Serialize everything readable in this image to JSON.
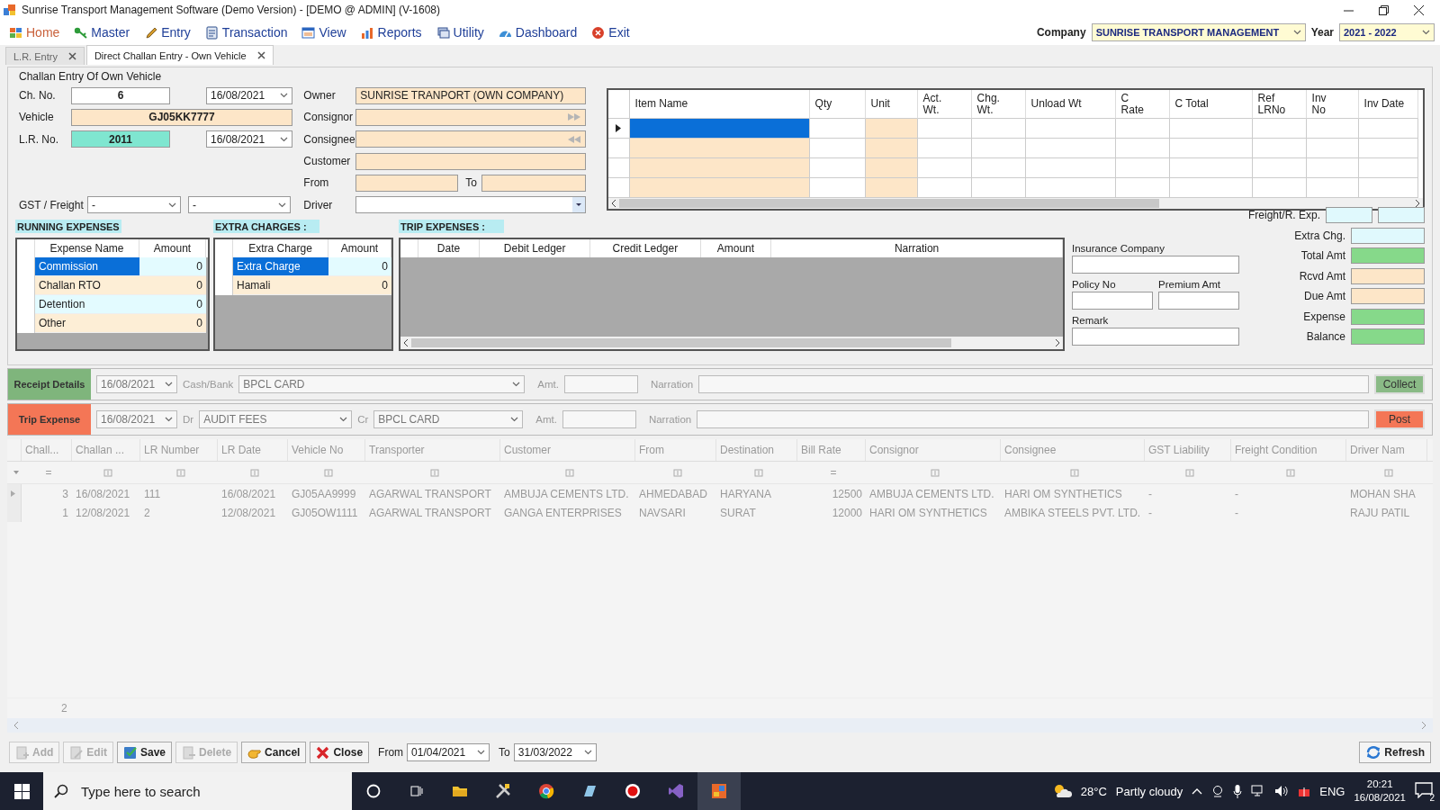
{
  "window": {
    "title": "Sunrise Transport Management Software (Demo Version) - [DEMO @ ADMIN] (V-1608)"
  },
  "menu": [
    {
      "label": "Home",
      "selected": true
    },
    {
      "label": "Master",
      "selected": false
    },
    {
      "label": "Entry",
      "selected": false
    },
    {
      "label": "Transaction",
      "selected": false
    },
    {
      "label": "View",
      "selected": false
    },
    {
      "label": "Reports",
      "selected": false
    },
    {
      "label": "Utility",
      "selected": false
    },
    {
      "label": "Dashboard",
      "selected": false
    },
    {
      "label": "Exit",
      "selected": false
    }
  ],
  "company": {
    "label": "Company",
    "value": "SUNRISE TRANSPORT MANAGEMENT"
  },
  "year": {
    "label": "Year",
    "value": "2021 - 2022"
  },
  "tabs": [
    {
      "label": "L.R. Entry",
      "selected": false
    },
    {
      "label": "Direct Challan Entry - Own Vehicle",
      "selected": true
    }
  ],
  "challan_form": {
    "title": "Challan Entry Of Own Vehicle",
    "ch_no": {
      "label": "Ch. No.",
      "value": "6",
      "date": "16/08/2021"
    },
    "vehicle": {
      "label": "Vehicle",
      "value": "GJ05KK7777"
    },
    "lr_no": {
      "label": "L.R. No.",
      "value": "2011",
      "date": "16/08/2021"
    },
    "gst_freight": {
      "label": "GST / Freight",
      "values": [
        "-",
        "-"
      ]
    },
    "owner": {
      "label": "Owner",
      "value": "SUNRISE TRANPORT (OWN COMPANY)"
    },
    "consignor": {
      "label": "Consignor"
    },
    "consignee": {
      "label": "Consignee"
    },
    "customer": {
      "label": "Customer"
    },
    "from": {
      "label": "From"
    },
    "to": {
      "label": "To"
    },
    "driver": {
      "label": "Driver"
    }
  },
  "item_grid": {
    "columns": [
      {
        "label": "Item Name",
        "required": true
      },
      {
        "label": "Qty",
        "required": false
      },
      {
        "label": "Unit",
        "required": true
      },
      {
        "label": "Act.\nWt.",
        "required": false
      },
      {
        "label": "Chg.\nWt.",
        "required": false
      },
      {
        "label": "Unload Wt",
        "required": false
      },
      {
        "label": "C\nRate",
        "required": false
      },
      {
        "label": "C Total",
        "required": false
      },
      {
        "label": "Ref\nLRNo",
        "required": false
      },
      {
        "label": "Inv\nNo",
        "required": false
      },
      {
        "label": "Inv Date",
        "required": false
      }
    ],
    "rows": [
      {
        "selected": true
      },
      {
        "selected": false
      },
      {
        "selected": false
      },
      {
        "selected": false
      }
    ]
  },
  "running_expenses": {
    "title": "RUNNING EXPENSES",
    "columns": [
      "Expense Name",
      "Amount"
    ],
    "rows": [
      {
        "name": "Commission",
        "amount": "0",
        "selected": true
      },
      {
        "name": "Challan RTO",
        "amount": "0",
        "selected": false
      },
      {
        "name": "Detention",
        "amount": "0",
        "selected": false
      },
      {
        "name": "Other",
        "amount": "0",
        "selected": false
      }
    ]
  },
  "extra_charges": {
    "title": "EXTRA CHARGES :",
    "columns": [
      "Extra Charge",
      "Amount"
    ],
    "rows": [
      {
        "name": "Extra Charge",
        "amount": "0",
        "selected": true
      },
      {
        "name": "Hamali",
        "amount": "0",
        "selected": false
      }
    ]
  },
  "trip_expenses": {
    "title": "TRIP EXPENSES :",
    "columns": [
      "Date",
      "Debit Ledger",
      "Credit Ledger",
      "Amount",
      "Narration"
    ]
  },
  "insurance": {
    "company_label": "Insurance Company",
    "policy_label": "Policy No",
    "premium_label": "Premium Amt",
    "remark_label": "Remark"
  },
  "totals": [
    {
      "label": "Freight/R. Exp.",
      "kind": "double",
      "color": "#e0f9fd"
    },
    {
      "label": "Extra Chg.",
      "kind": "single",
      "color": "#e0f9fd"
    },
    {
      "label": "Total Amt",
      "kind": "single",
      "color": "#86d98a"
    },
    {
      "label": "Rcvd Amt",
      "kind": "single",
      "color": "#fde6c8"
    },
    {
      "label": "Due Amt",
      "kind": "single",
      "color": "#fde6c8"
    },
    {
      "label": "Expense",
      "kind": "single",
      "color": "#86d98a"
    },
    {
      "label": "Balance",
      "kind": "single",
      "color": "#86d98a"
    }
  ],
  "receipt": {
    "label": "Receipt Details",
    "date": "16/08/2021",
    "account_label": "Cash/Bank",
    "account": "BPCL CARD",
    "amount_label": "Amt.",
    "narration_label": "Narration",
    "button": "Collect"
  },
  "trip_expense": {
    "label": "Trip Expense",
    "date": "16/08/2021",
    "debit_label": "Dr",
    "debit": "AUDIT FEES",
    "credit_label": "Cr",
    "credit": "BPCL CARD",
    "amount_label": "Amt.",
    "narration_label": "Narration",
    "button": "Post"
  },
  "challan_list": {
    "columns": [
      "Chall...",
      "Challan ...",
      "LR Number",
      "LR Date",
      "Vehicle No",
      "Transporter",
      "Customer",
      "From",
      "Destination",
      "Bill Rate",
      "Consignor",
      "Consignee",
      "GST Liability",
      "Freight Condition",
      "Driver Nam"
    ],
    "filters": [
      {
        "kind": "text",
        "text": "="
      },
      {
        "kind": "icon"
      },
      {
        "kind": "icon"
      },
      {
        "kind": "icon"
      },
      {
        "kind": "icon"
      },
      {
        "kind": "icon"
      },
      {
        "kind": "icon"
      },
      {
        "kind": "icon"
      },
      {
        "kind": "icon"
      },
      {
        "kind": "text",
        "text": "="
      },
      {
        "kind": "icon"
      },
      {
        "kind": "icon"
      },
      {
        "kind": "icon"
      },
      {
        "kind": "icon"
      },
      {
        "kind": "icon"
      }
    ],
    "rows": [
      {
        "selected": true,
        "cells": [
          "3",
          "16/08/2021",
          "111",
          "16/08/2021",
          "GJ05AA9999",
          "AGARWAL TRANSPORT",
          "AMBUJA CEMENTS LTD.",
          "AHMEDABAD",
          "HARYANA",
          "12500",
          "AMBUJA CEMENTS LTD.",
          "HARI OM SYNTHETICS",
          "-",
          "-",
          "MOHAN SHA"
        ]
      },
      {
        "selected": false,
        "cells": [
          "1",
          "12/08/2021",
          "2",
          "12/08/2021",
          "GJ05OW1111",
          "AGARWAL TRANSPORT",
          "GANGA ENTERPRISES",
          "NAVSARI",
          "SURAT",
          "12000",
          "HARI OM SYNTHETICS",
          "AMBIKA STEELS PVT. LTD.",
          "-",
          "-",
          "RAJU PATIL"
        ]
      }
    ],
    "count": "2"
  },
  "toolbar": {
    "buttons": [
      {
        "label": "Add",
        "disabled": true
      },
      {
        "label": "Edit",
        "disabled": true
      },
      {
        "label": "Save",
        "disabled": false
      },
      {
        "label": "Delete",
        "disabled": true
      },
      {
        "label": "Cancel",
        "disabled": false
      },
      {
        "label": "Close",
        "disabled": false
      }
    ],
    "from_label": "From",
    "from": "01/04/2021",
    "to_label": "To",
    "to": "31/03/2022",
    "refresh": "Refresh"
  },
  "taskbar": {
    "search_placeholder": "Type here to search",
    "temperature": "28°C",
    "condition": "Partly cloudy",
    "language": "ENG",
    "time": "20:21",
    "date": "16/08/2021",
    "notifications": "2"
  }
}
